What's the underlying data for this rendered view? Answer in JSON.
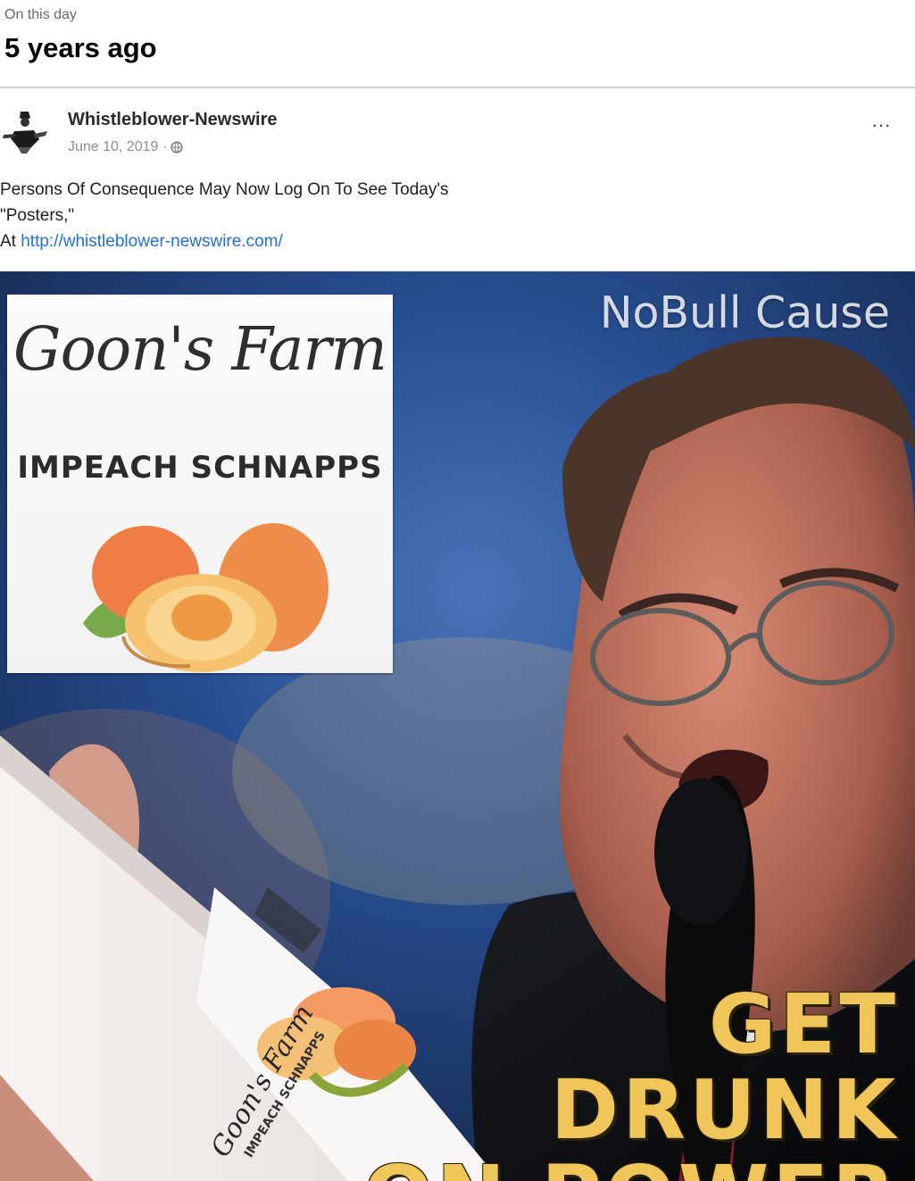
{
  "memory": {
    "kicker": "On this day",
    "title": "5 years ago"
  },
  "post": {
    "author": "Whistleblower-Newswire",
    "date": "June 10, 2019 ·",
    "privacy_icon": "globe-icon",
    "more_label": "···",
    "text_line1": "Persons Of Consequence May Now Log On To See Today's",
    "text_line2": "\"Posters,\"",
    "text_prefix": "At",
    "link": "http://whistleblower-newswire.com/"
  },
  "image": {
    "watermark": "NoBull Cause",
    "card_brand": "Goon's Farm",
    "card_product": "IMPEACH SCHNAPPS",
    "bottle_brand": "Goon's Farm",
    "bottle_product": "IMPEACH SCHNAPPS",
    "headline_line1": "GET DRUNK",
    "headline_line2": "ON POWER",
    "headline_color": "#f0c65a"
  }
}
